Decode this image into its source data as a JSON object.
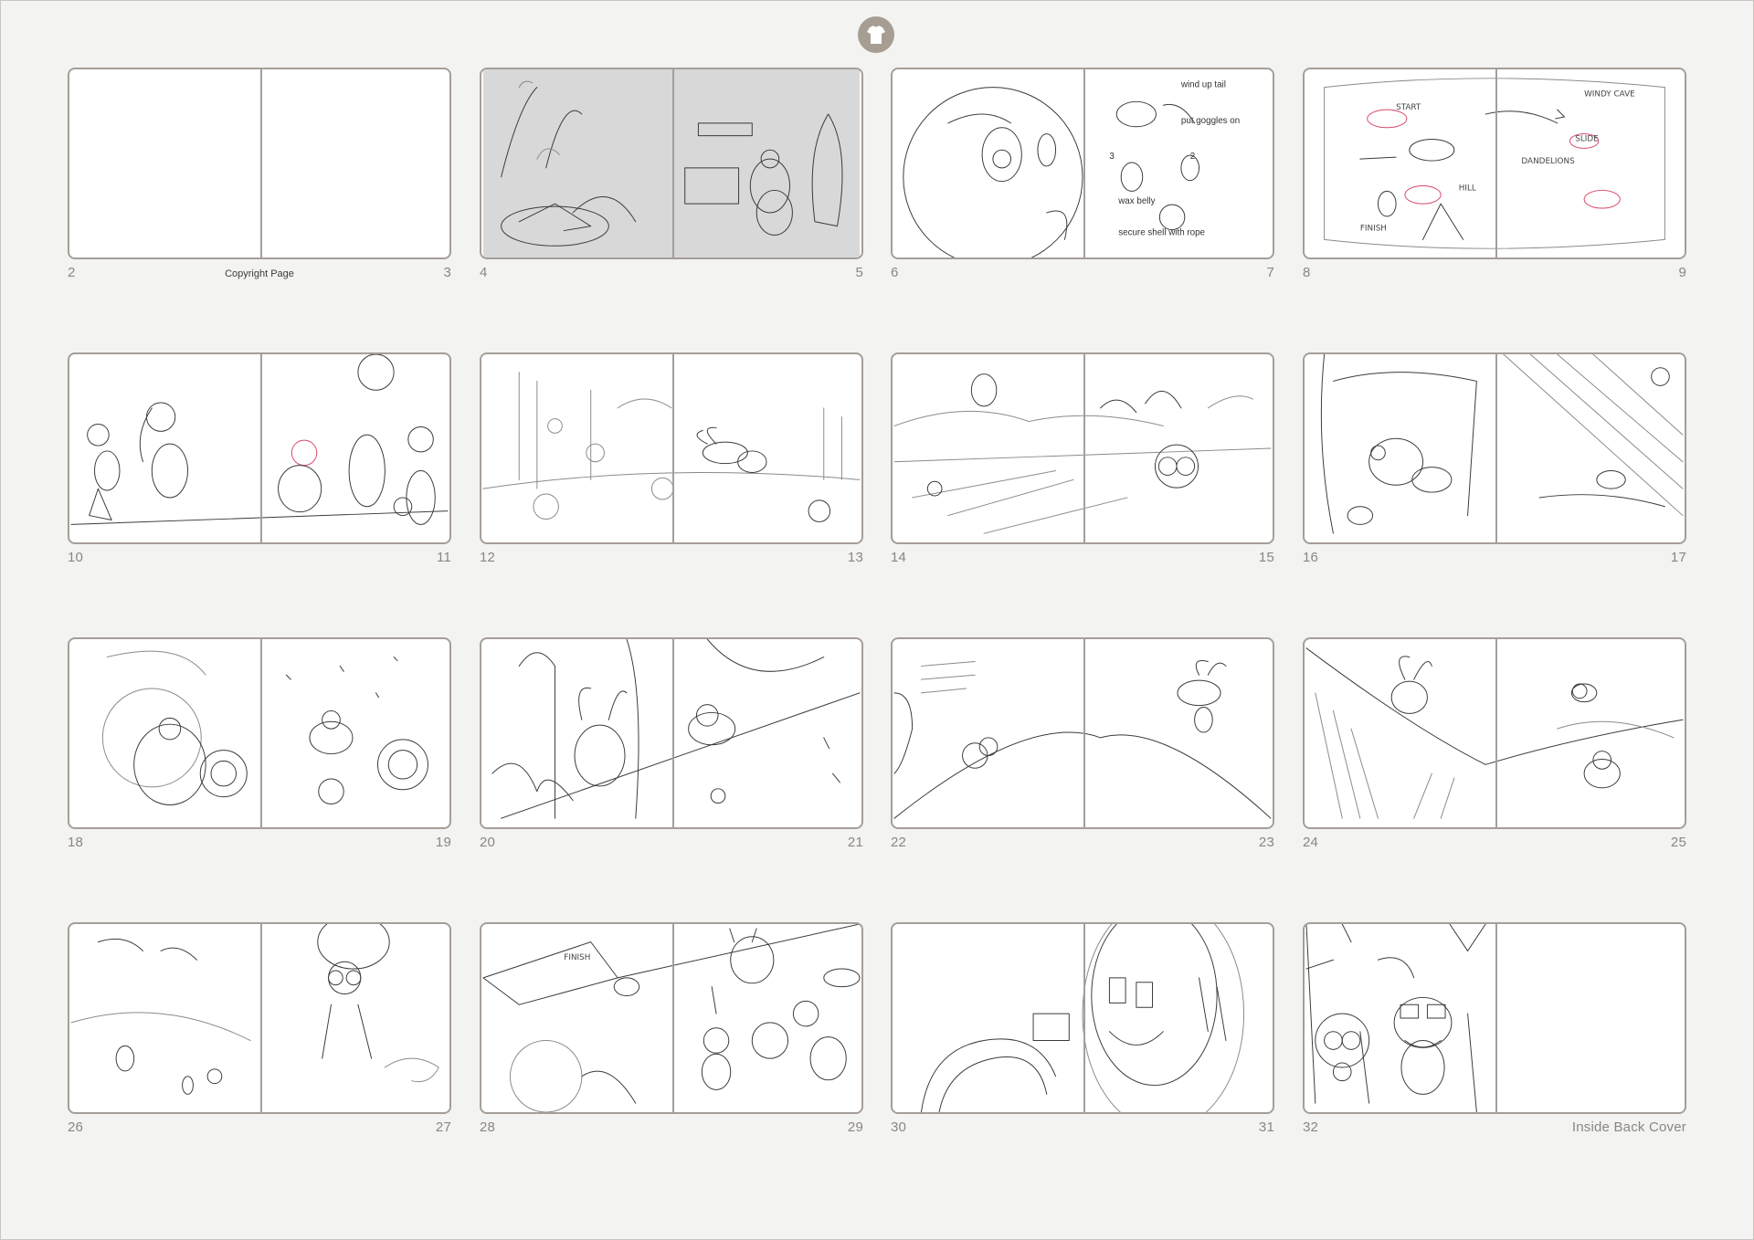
{
  "spreads": [
    {
      "left_page": "2",
      "right_page": "3",
      "caption": "Copyright Page"
    },
    {
      "left_page": "4",
      "right_page": "5"
    },
    {
      "left_page": "6",
      "right_page": "7",
      "notes": [
        "wind up tail",
        "put goggles on",
        "wax belly",
        "secure shell with rope",
        "3",
        "2"
      ]
    },
    {
      "left_page": "8",
      "right_page": "9",
      "notes": [
        "START",
        "WINDY CAVE",
        "DANDELIONS",
        "HILL",
        "FINISH",
        "SLIDE"
      ]
    },
    {
      "left_page": "10",
      "right_page": "11"
    },
    {
      "left_page": "12",
      "right_page": "13"
    },
    {
      "left_page": "14",
      "right_page": "15"
    },
    {
      "left_page": "16",
      "right_page": "17"
    },
    {
      "left_page": "18",
      "right_page": "19"
    },
    {
      "left_page": "20",
      "right_page": "21"
    },
    {
      "left_page": "22",
      "right_page": "23"
    },
    {
      "left_page": "24",
      "right_page": "25"
    },
    {
      "left_page": "26",
      "right_page": "27"
    },
    {
      "left_page": "28",
      "right_page": "29",
      "notes": [
        "FINISH"
      ]
    },
    {
      "left_page": "30",
      "right_page": "31"
    },
    {
      "left_page": "32",
      "right_page": "Inside Back Cover"
    }
  ],
  "colors": {
    "background": "#f3f3f1",
    "border": "#a59e98",
    "page_number": "#8c8680",
    "logo": "#a69d93"
  },
  "icons": {
    "logo": "tshirt-logo-icon"
  }
}
